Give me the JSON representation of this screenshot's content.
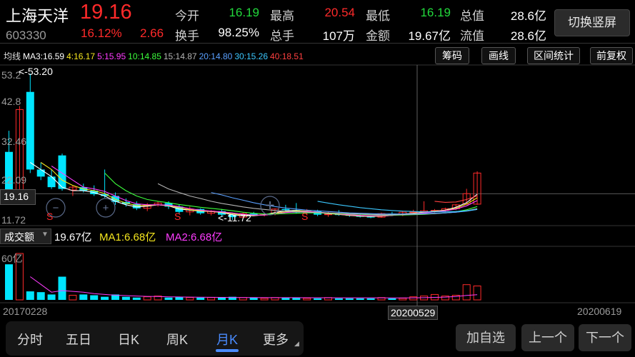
{
  "stock": {
    "name": "上海天洋",
    "code": "603330",
    "price": "19.16",
    "change_pct": "16.12%",
    "change": "2.66"
  },
  "quote": [
    {
      "label": "今开",
      "value": "16.19",
      "color": "green"
    },
    {
      "label": "最高",
      "value": "20.54",
      "color": "red"
    },
    {
      "label": "最低",
      "value": "16.19",
      "color": "green"
    },
    {
      "label": "总值",
      "value": "28.6亿",
      "color": "white"
    },
    {
      "label": "换手",
      "value": "98.25%",
      "color": "white"
    },
    {
      "label": "总手",
      "value": "107万",
      "color": "white"
    },
    {
      "label": "金额",
      "value": "19.67亿",
      "color": "white"
    },
    {
      "label": "流值",
      "value": "28.6亿",
      "color": "white"
    }
  ],
  "switch_button": "切换竖屏",
  "ma_bar": {
    "title": "均线",
    "items": [
      {
        "label": "MA3:16.59",
        "color": "#ffffff"
      },
      {
        "label": "4:16.17",
        "color": "#f5e61e"
      },
      {
        "label": "5:15.95",
        "color": "#ff3cff"
      },
      {
        "label": "10:14.85",
        "color": "#3cff3c"
      },
      {
        "label": "15:14.87",
        "color": "#b4b4b4"
      },
      {
        "label": "20:14.80",
        "color": "#5aa0ff"
      },
      {
        "label": "30:15.26",
        "color": "#3cc8ff"
      },
      {
        "label": "40:18.51",
        "color": "#ff4040"
      }
    ]
  },
  "tools": [
    "筹码",
    "画线",
    "区间统计",
    "前复权"
  ],
  "price_axis": {
    "labels": [
      "53.2",
      "42.8",
      "32.46",
      "22.09",
      "11.72"
    ],
    "current": "19.16"
  },
  "annotations": {
    "high": "<-53.20",
    "low": "<-11.72",
    "signal": "S"
  },
  "volume": {
    "title": "成交额",
    "value": "19.67亿",
    "ma1": "MA1:6.68亿",
    "ma2": "MA2:6.68亿",
    "axis_top": "60亿"
  },
  "dates": {
    "start": "20170228",
    "cursor": "20200529",
    "end": "20200619"
  },
  "tabs": [
    "分时",
    "五日",
    "日K",
    "周K",
    "月K",
    "更多"
  ],
  "active_tab": "月K",
  "nav": {
    "favorite": "加自选",
    "prev": "上一个",
    "next": "下一个"
  },
  "colors": {
    "up": "#ff2a2a",
    "down": "#00e5ff",
    "accent": "#4a8cff"
  },
  "chart_data": {
    "type": "candlestick",
    "period": "monthly",
    "y_range": [
      11.72,
      53.2
    ],
    "candles": [
      {
        "o": 31.0,
        "h": 37.0,
        "l": 17.0,
        "c": 18.0
      },
      {
        "o": 18.0,
        "h": 44.0,
        "l": 17.5,
        "c": 43.0
      },
      {
        "o": 48.0,
        "h": 53.2,
        "l": 25.0,
        "c": 26.0
      },
      {
        "o": 26.0,
        "h": 28.0,
        "l": 23.0,
        "c": 24.0
      },
      {
        "o": 24.0,
        "h": 26.0,
        "l": 20.5,
        "c": 21.0
      },
      {
        "o": 30.0,
        "h": 30.5,
        "l": 20.0,
        "c": 20.5
      },
      {
        "o": 20.2,
        "h": 21.5,
        "l": 18.5,
        "c": 21.0
      },
      {
        "o": 21.0,
        "h": 22.0,
        "l": 19.5,
        "c": 20.0
      },
      {
        "o": 20.0,
        "h": 21.5,
        "l": 18.5,
        "c": 19.0
      },
      {
        "o": 19.0,
        "h": 26.0,
        "l": 18.0,
        "c": 18.5
      },
      {
        "o": 18.5,
        "h": 19.5,
        "l": 16.0,
        "c": 16.8
      },
      {
        "o": 16.8,
        "h": 17.8,
        "l": 15.5,
        "c": 16.2
      },
      {
        "o": 16.2,
        "h": 17.0,
        "l": 14.5,
        "c": 15.0
      },
      {
        "o": 15.0,
        "h": 16.5,
        "l": 14.2,
        "c": 16.0
      },
      {
        "o": 16.0,
        "h": 17.0,
        "l": 15.5,
        "c": 16.5
      },
      {
        "o": 16.5,
        "h": 17.0,
        "l": 14.8,
        "c": 15.5
      },
      {
        "o": 15.5,
        "h": 16.0,
        "l": 13.5,
        "c": 14.0
      },
      {
        "o": 14.0,
        "h": 15.5,
        "l": 13.0,
        "c": 14.8
      },
      {
        "o": 14.8,
        "h": 15.0,
        "l": 13.2,
        "c": 13.6
      },
      {
        "o": 13.6,
        "h": 14.5,
        "l": 13.0,
        "c": 14.2
      },
      {
        "o": 14.2,
        "h": 14.8,
        "l": 12.8,
        "c": 13.2
      },
      {
        "o": 13.2,
        "h": 13.8,
        "l": 11.72,
        "c": 12.5
      },
      {
        "o": 12.5,
        "h": 13.8,
        "l": 12.3,
        "c": 13.5
      },
      {
        "o": 13.5,
        "h": 14.0,
        "l": 12.8,
        "c": 13.1
      },
      {
        "o": 13.1,
        "h": 13.6,
        "l": 12.7,
        "c": 13.4
      },
      {
        "o": 13.4,
        "h": 15.0,
        "l": 13.0,
        "c": 14.8
      },
      {
        "o": 14.8,
        "h": 16.0,
        "l": 14.0,
        "c": 14.5
      },
      {
        "o": 14.5,
        "h": 16.5,
        "l": 13.5,
        "c": 13.8
      },
      {
        "o": 13.8,
        "h": 14.8,
        "l": 13.0,
        "c": 14.2
      },
      {
        "o": 14.2,
        "h": 14.6,
        "l": 12.8,
        "c": 13.2
      },
      {
        "o": 13.2,
        "h": 14.0,
        "l": 12.6,
        "c": 13.4
      },
      {
        "o": 13.4,
        "h": 14.5,
        "l": 12.9,
        "c": 13.1
      },
      {
        "o": 13.1,
        "h": 13.5,
        "l": 12.6,
        "c": 12.9
      },
      {
        "o": 12.9,
        "h": 13.2,
        "l": 12.4,
        "c": 12.6
      },
      {
        "o": 12.6,
        "h": 13.0,
        "l": 12.2,
        "c": 12.5
      },
      {
        "o": 12.5,
        "h": 13.8,
        "l": 12.3,
        "c": 13.5
      },
      {
        "o": 13.5,
        "h": 14.0,
        "l": 12.9,
        "c": 13.2
      },
      {
        "o": 13.2,
        "h": 14.2,
        "l": 12.8,
        "c": 13.9
      },
      {
        "o": 13.9,
        "h": 14.6,
        "l": 13.4,
        "c": 14.0
      },
      {
        "o": 14.0,
        "h": 17.0,
        "l": 13.5,
        "c": 14.3
      },
      {
        "o": 14.3,
        "h": 14.8,
        "l": 13.8,
        "c": 14.4
      },
      {
        "o": 14.4,
        "h": 15.2,
        "l": 14.0,
        "c": 14.9
      },
      {
        "o": 14.9,
        "h": 16.2,
        "l": 14.5,
        "c": 16.0
      },
      {
        "o": 16.19,
        "h": 20.54,
        "l": 16.19,
        "c": 19.16
      },
      {
        "o": 16.19,
        "h": 25.5,
        "l": 16.0,
        "c": 25.0
      }
    ],
    "volume_yi": [
      46,
      60,
      11,
      10,
      7,
      30,
      6,
      7,
      6,
      4,
      7,
      4,
      3,
      4,
      5,
      3,
      4,
      3,
      3,
      3,
      3,
      4,
      3,
      3,
      2,
      3,
      3,
      3,
      2,
      2,
      3,
      2,
      2,
      2,
      2,
      3,
      2,
      2,
      4,
      5,
      7,
      5,
      6,
      19.67,
      18
    ],
    "ma_lines": [
      {
        "name": "MA3",
        "color": "#ffffff",
        "values": [
          null,
          null,
          28,
          26,
          24,
          21,
          20,
          20,
          19.5,
          18.5,
          17,
          16,
          15.4,
          15.6,
          16,
          15.7,
          14.8,
          14.5,
          14.2,
          14.1,
          13.8,
          13.2,
          12.9,
          12.9,
          13.2,
          13.8,
          14.3,
          14.4,
          14.2,
          13.8,
          13.5,
          13.3,
          13.0,
          12.8,
          12.7,
          12.8,
          13.0,
          13.4,
          13.6,
          13.9,
          14.2,
          14.5,
          15.3,
          16.6,
          19.0
        ]
      },
      {
        "name": "4",
        "color": "#f5e61e",
        "values": [
          null,
          null,
          null,
          28,
          26,
          23,
          21.5,
          20.5,
          20,
          19.2,
          17.5,
          16.5,
          15.8,
          15.8,
          16,
          15.8,
          15.2,
          14.6,
          14.3,
          14.1,
          13.9,
          13.5,
          13.1,
          13.0,
          13.1,
          13.6,
          14.0,
          14.2,
          14.2,
          13.9,
          13.6,
          13.3,
          13.1,
          12.9,
          12.8,
          12.8,
          13.0,
          13.3,
          13.5,
          13.8,
          14.1,
          14.4,
          15.0,
          16.2,
          18.0
        ]
      },
      {
        "name": "5",
        "color": "#ff3cff",
        "values": [
          null,
          null,
          null,
          null,
          27,
          25,
          23,
          21,
          20.5,
          19.8,
          18.5,
          17.2,
          16.3,
          16,
          16,
          15.9,
          15.5,
          14.9,
          14.5,
          14.2,
          14.0,
          13.7,
          13.3,
          13.1,
          13.1,
          13.4,
          13.8,
          14.0,
          14.1,
          13.9,
          13.7,
          13.4,
          13.2,
          13.0,
          12.9,
          12.9,
          13.0,
          13.2,
          13.4,
          13.7,
          14.0,
          14.3,
          14.8,
          15.7,
          17.2
        ]
      },
      {
        "name": "10",
        "color": "#3cff3c",
        "values": [
          null,
          null,
          null,
          null,
          null,
          null,
          null,
          null,
          null,
          25,
          22,
          20,
          18.5,
          17.5,
          17,
          16.6,
          16.1,
          15.7,
          15.3,
          15.0,
          14.7,
          14.3,
          13.9,
          13.6,
          13.4,
          13.4,
          13.5,
          13.6,
          13.7,
          13.7,
          13.6,
          13.5,
          13.4,
          13.3,
          13.2,
          13.1,
          13.1,
          13.1,
          13.2,
          13.3,
          13.5,
          13.7,
          14.0,
          14.6,
          15.5
        ]
      },
      {
        "name": "15",
        "color": "#b4b4b4",
        "values": [
          null,
          null,
          null,
          null,
          null,
          null,
          null,
          null,
          null,
          null,
          null,
          null,
          null,
          null,
          22,
          20.5,
          19.5,
          18.5,
          17.8,
          17.0,
          16.4,
          15.9,
          15.4,
          15.0,
          14.7,
          14.4,
          14.2,
          14.0,
          13.9,
          13.8,
          13.7,
          13.6,
          13.5,
          13.4,
          13.3,
          13.2,
          13.2,
          13.2,
          13.3,
          13.4,
          13.5,
          13.7,
          13.9,
          14.3,
          14.9
        ]
      },
      {
        "name": "20",
        "color": "#5aa0ff",
        "values": [
          null,
          null,
          null,
          null,
          null,
          null,
          null,
          null,
          null,
          null,
          null,
          null,
          null,
          null,
          null,
          null,
          null,
          null,
          null,
          19.5,
          18.8,
          18.0,
          17.3,
          16.6,
          16.0,
          15.5,
          15.1,
          14.8,
          14.5,
          14.3,
          14.1,
          13.9,
          13.7,
          13.6,
          13.5,
          13.4,
          13.4,
          13.4,
          13.4,
          13.5,
          13.6,
          13.7,
          13.9,
          14.2,
          14.7
        ]
      },
      {
        "name": "30",
        "color": "#3cc8ff",
        "values": [
          null,
          null,
          null,
          null,
          null,
          null,
          null,
          null,
          null,
          null,
          null,
          null,
          null,
          null,
          null,
          null,
          null,
          null,
          null,
          null,
          null,
          null,
          null,
          null,
          null,
          null,
          null,
          null,
          null,
          17.0,
          16.5,
          16.0,
          15.6,
          15.2,
          14.9,
          14.6,
          14.4,
          14.2,
          14.1,
          14.0,
          14.0,
          14.0,
          14.1,
          14.3,
          14.7
        ]
      },
      {
        "name": "40",
        "color": "#ff4040",
        "values": [
          null,
          null,
          null,
          null,
          null,
          null,
          null,
          null,
          null,
          null,
          null,
          null,
          null,
          null,
          null,
          null,
          null,
          null,
          null,
          null,
          null,
          null,
          null,
          null,
          null,
          null,
          null,
          null,
          null,
          null,
          null,
          null,
          null,
          null,
          null,
          null,
          null,
          null,
          null,
          null,
          17.0,
          16.7,
          16.8,
          17.5,
          18.51
        ]
      }
    ],
    "volume_ma": [
      null,
      null,
      30,
      20,
      10,
      12,
      11,
      10,
      8,
      7,
      6,
      5.5,
      5,
      4.5,
      4.3,
      4,
      3.8,
      3.6,
      3.4,
      3.3,
      3.2,
      3.1,
      3.0,
      3.0,
      2.9,
      2.9,
      2.9,
      2.9,
      2.8,
      2.8,
      2.8,
      2.7,
      2.7,
      2.7,
      2.7,
      2.7,
      2.6,
      2.6,
      2.7,
      2.9,
      3.2,
      3.6,
      4.3,
      5.8,
      6.68
    ]
  }
}
